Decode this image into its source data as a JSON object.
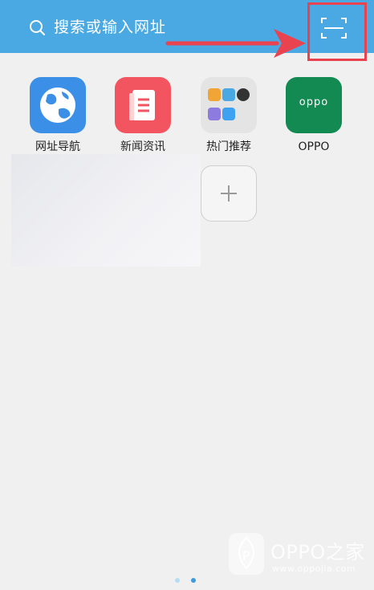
{
  "search": {
    "placeholder": "搜索或输入网址",
    "icon": "search-icon",
    "scan_icon": "scan-icon"
  },
  "colors": {
    "topbar": "#4aa8e3",
    "annotation": "#e8434f",
    "background": "#f0f0f0"
  },
  "apps": [
    {
      "label": "网址导航",
      "icon": "globe-icon",
      "color": "#3b8fe6"
    },
    {
      "label": "新闻资讯",
      "icon": "news-icon",
      "color": "#f25560"
    },
    {
      "label": "热门推荐",
      "icon": "folder-icon",
      "color": "#e4e4e4"
    },
    {
      "label": "OPPO",
      "icon": "oppo-logo",
      "color": "#128a52",
      "logo_text": "oppo"
    }
  ],
  "add_button": {
    "icon": "plus-icon"
  },
  "pager": {
    "pages": 2,
    "current": 2
  },
  "watermark": {
    "title": "OPPO之家",
    "url": "www.oppojia.com"
  }
}
